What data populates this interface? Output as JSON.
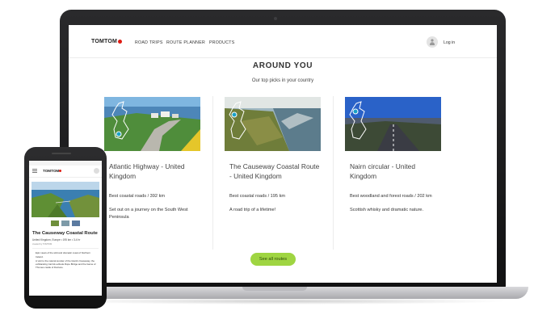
{
  "nav": {
    "logo": "TOMTOM",
    "links": [
      "ROAD TRIPS",
      "ROUTE PLANNER",
      "PRODUCTS"
    ],
    "login": "Log in"
  },
  "main": {
    "heading": "AROUND YOU",
    "subheading": "Our top picks in your country",
    "cards": [
      {
        "title": "Atlantic Highway - United Kingdom",
        "meta": "Best coastal roads / 392 km",
        "desc": "Set out on a journey on the South West Peninsula"
      },
      {
        "title": "The Causeway Coastal Route - United Kingdom",
        "meta": "Best coastal roads / 195 km",
        "desc": "A road trip of a lifetime!"
      },
      {
        "title": "Nairn circular - United Kingdom",
        "meta": "Best woodland and forest roads / 202 km",
        "desc": "Scottish whisky and dramatic nature."
      }
    ],
    "see_all": "See all routes"
  },
  "phone": {
    "logo": "TOMTOM",
    "title": "The Causeway Coastal Route",
    "subtitle": "United Kingdom, Europe  •  195 km  •  3-4 hr",
    "credit": "created by TOMTOM",
    "bullets": [
      "Epic views of the wild and dramatic coast of Northern Ireland.",
      "A visit to the natural wonder of the Giant's Causeway, the exhilarating Carrick-a-Rede Rope Bridge and the Game of Thrones castle of Dunluce."
    ]
  },
  "colors": {
    "accent_green": "#9fd542",
    "brand_red": "#df1b12"
  }
}
